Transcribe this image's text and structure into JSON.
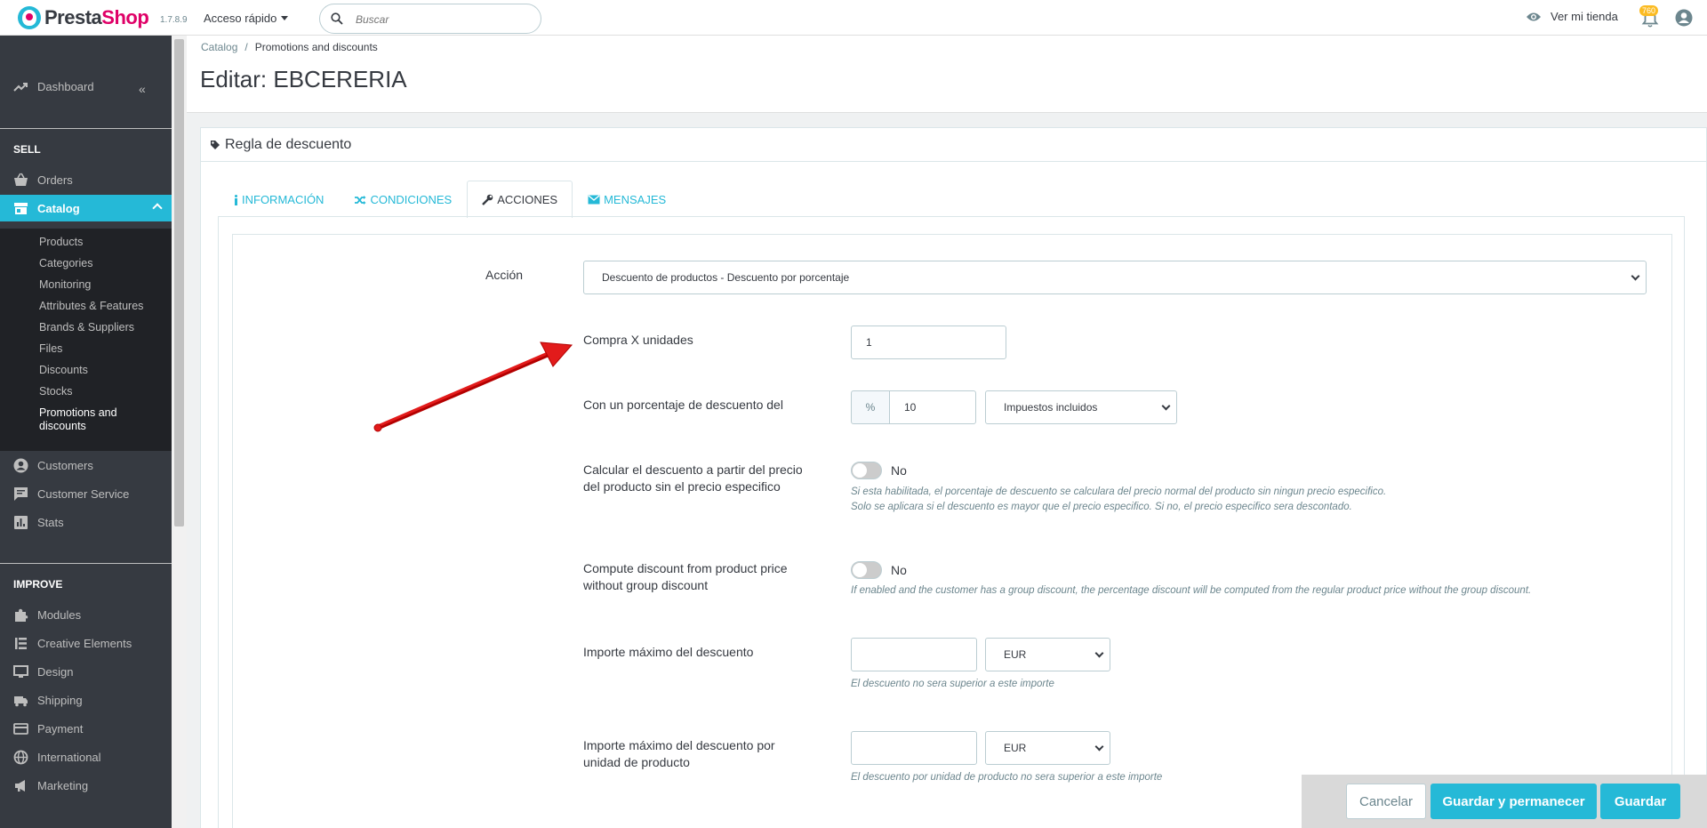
{
  "header": {
    "logo_text_1": "Presta",
    "logo_text_2": "Shop",
    "version": "1.7.8.9",
    "quick_access": "Acceso rápido",
    "search_placeholder": "Buscar",
    "view_store": "Ver mi tienda",
    "notifications_count": "760",
    "brand_color": "#df0067",
    "accent_color": "#25b9d7"
  },
  "sidebar": {
    "dashboard": "Dashboard",
    "sell_title": "SELL",
    "orders": "Orders",
    "catalog": "Catalog",
    "catalog_sub": [
      "Products",
      "Categories",
      "Monitoring",
      "Attributes & Features",
      "Brands & Suppliers",
      "Files",
      "Discounts",
      "Stocks",
      "Promotions and",
      "discounts"
    ],
    "customers": "Customers",
    "customer_service": "Customer Service",
    "stats": "Stats",
    "improve_title": "IMPROVE",
    "modules": "Modules",
    "creative_elements": "Creative Elements",
    "design": "Design",
    "shipping": "Shipping",
    "payment": "Payment",
    "international": "International",
    "marketing": "Marketing"
  },
  "breadcrumb": {
    "parent": "Catalog",
    "separator": "/",
    "current": "Promotions and discounts"
  },
  "page_title": "Editar: EBCERERIA",
  "panel": {
    "heading": "Regla de descuento",
    "tabs": [
      "INFORMACIÓN",
      "CONDICIONES",
      "ACCIONES",
      "MENSAJES"
    ]
  },
  "form": {
    "accion_label": "Acción",
    "accion_value": "Descuento de productos - Descuento por porcentaje",
    "buy_x_label": "Compra X unidades",
    "buy_x_value": "1",
    "percent_label": "Con un porcentaje de descuento del",
    "percent_addon": "%",
    "percent_value": "10",
    "tax_value": "Impuestos incluidos",
    "calc_label_1": "Calcular el descuento a partir del precio",
    "calc_label_2": "del producto sin el precio especifico",
    "calc_toggle": "No",
    "calc_help_1": "Si esta habilitada, el porcentaje de descuento se calculara del precio normal del producto sin ningun precio especifico.",
    "calc_help_2": "Solo se aplicara si el descuento es mayor que el precio especifico. Si no, el precio especifico sera descontado.",
    "group_label_1": "Compute discount from product price",
    "group_label_2": "without group discount",
    "group_toggle": "No",
    "group_help": "If enabled and the customer has a group discount, the percentage discount will be computed from the regular product price without the group discount.",
    "max_label": "Importe máximo del descuento",
    "max_currency": "EUR",
    "max_help": "El descuento no sera superior a este importe",
    "max_unit_label_1": "Importe máximo del descuento por",
    "max_unit_label_2": "unidad de producto",
    "max_unit_currency": "EUR",
    "max_unit_help": "El descuento por unidad de producto no sera superior a este importe"
  },
  "footer": {
    "cancel": "Cancelar",
    "save_stay": "Guardar y permanecer",
    "save": "Guardar"
  }
}
